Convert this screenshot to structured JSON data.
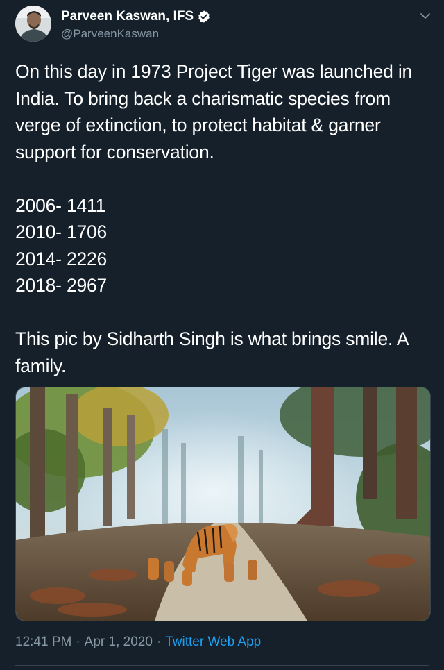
{
  "author": {
    "display_name": "Parveen Kaswan, IFS",
    "handle": "@ParveenKaswan"
  },
  "tweet": {
    "paragraph1": "On this day in 1973 Project Tiger was launched in India. To bring back a charismatic species from verge of extinction, to protect habitat & garner support for conservation.",
    "stats": [
      "2006- 1411",
      "2010- 1706",
      "2014- 2226",
      "2018- 2967"
    ],
    "paragraph2": "This pic by Sidharth Singh is what brings smile. A family."
  },
  "meta": {
    "time": "12:41 PM",
    "separator": "·",
    "date": "Apr 1, 2020",
    "source": "Twitter Web App"
  },
  "icons": {
    "verified": "verified-badge-icon",
    "more": "chevron-down-icon"
  },
  "colors": {
    "background": "#15202b",
    "secondary_text": "#8899a6",
    "link": "#1da1f2",
    "verified": "#ffffff"
  }
}
